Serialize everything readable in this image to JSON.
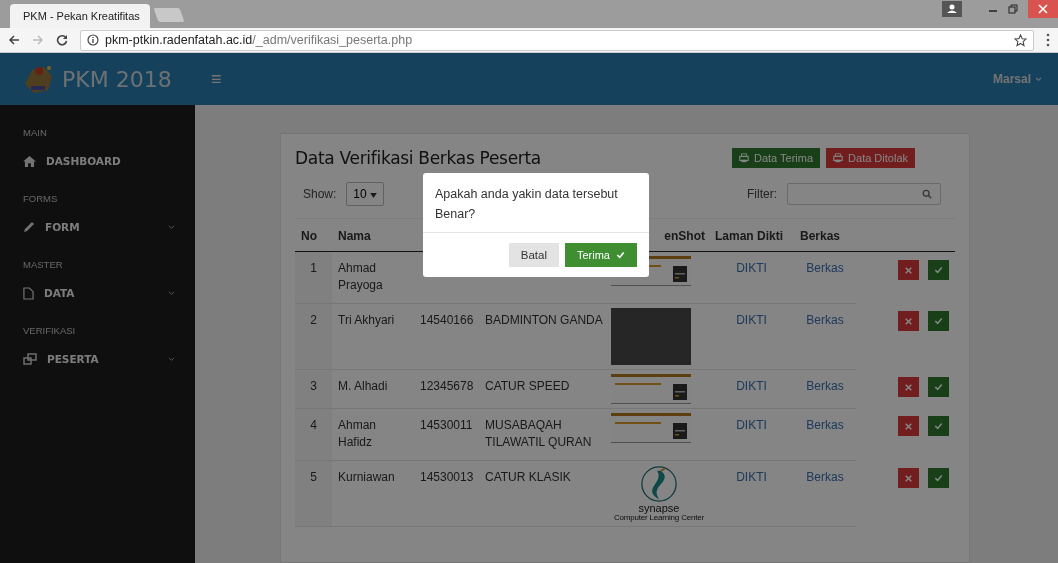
{
  "browser": {
    "tab_title": "PKM - Pekan Kreatifitas",
    "url_host": "pkm-ptkin.radenfatah.ac.id",
    "url_path": "/_adm/verifikasi_peserta.php"
  },
  "header": {
    "brand": "PKM 2018",
    "menu_glyph": "≡",
    "user": "Marsal"
  },
  "sidebar": {
    "sections": [
      {
        "heading": "MAIN",
        "items": [
          {
            "label": "DASHBOARD",
            "expandable": false
          }
        ]
      },
      {
        "heading": "FORMS",
        "items": [
          {
            "label": "FORM",
            "expandable": true
          }
        ]
      },
      {
        "heading": "MASTER",
        "items": [
          {
            "label": "DATA",
            "expandable": true
          }
        ]
      },
      {
        "heading": "VERIFIKASI",
        "items": [
          {
            "label": "PESERTA",
            "expandable": true
          }
        ]
      }
    ]
  },
  "panel": {
    "title": "Data Verifikasi Berkas Peserta",
    "buttons": [
      {
        "label": "Data Terima",
        "kind": "accept"
      },
      {
        "label": "Data Ditolak",
        "kind": "reject"
      }
    ],
    "show_label": "Show:",
    "page_size": "10",
    "filter_label": "Filter:"
  },
  "table": {
    "columns": [
      {
        "label": "No"
      },
      {
        "label": "Nama"
      },
      {},
      {},
      {
        "label": "enShot"
      },
      {
        "label": "Laman Dikti"
      },
      {
        "label": "Berkas"
      },
      {}
    ],
    "rows": [
      {
        "no": "1",
        "nama": "Ahmad Prayoga",
        "screenshot": {
          "kind": "screenshot"
        },
        "laman": "DIKTI",
        "berkas": "Berkas"
      },
      {
        "no": "2",
        "nama": "Tri Akhyari",
        "nim": "14540166",
        "lomba": "BADMINTON GANDA",
        "screenshot": {
          "kind": "photo"
        },
        "laman": "DIKTI",
        "berkas": "Berkas"
      },
      {
        "no": "3",
        "nama": "M. Alhadi",
        "nim": "12345678",
        "lomba": "CATUR SPEED",
        "screenshot": {
          "kind": "screenshot"
        },
        "laman": "DIKTI",
        "berkas": "Berkas"
      },
      {
        "no": "4",
        "nama": "Ahman Hafidz",
        "nim": "14530011",
        "lomba": "MUSABAQAH TILAWATIL QURAN",
        "screenshot": {
          "kind": "screenshot"
        },
        "laman": "DIKTI",
        "berkas": "Berkas"
      },
      {
        "no": "5",
        "nama": "Kurniawan",
        "nim": "14530013",
        "lomba": "CATUR KLASIK",
        "screenshot": {
          "kind": "logo",
          "name": "synapse",
          "tagline": "Computer Learning Center"
        },
        "laman": "DIKTI",
        "berkas": "Berkas"
      }
    ]
  },
  "dialog": {
    "message": "Apakah anda yakin data tersebut Benar?",
    "buttons": [
      {
        "label": "Batal",
        "kind": "cancel"
      },
      {
        "label": "Terima",
        "kind": "confirm"
      }
    ]
  }
}
